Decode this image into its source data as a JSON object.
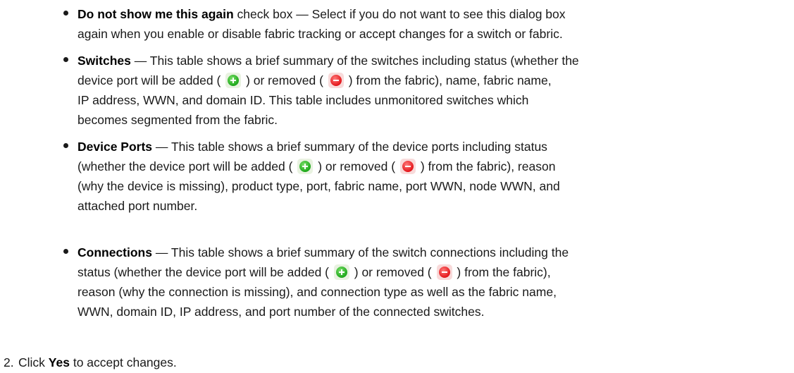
{
  "bullets": [
    {
      "term": "Do not show me this again",
      "lines": [
        " check box — Select if you do not want to see this dialog box",
        "again when you enable or disable fabric tracking or accept changes for a switch or fabric."
      ]
    },
    {
      "term": "Switches",
      "lines": [
        " — This table shows a brief summary of the switches including status (whether the",
        {
          "pre": "device port will be added (",
          "mid": ") or removed (",
          "post": ") from the fabric), name, fabric name,"
        },
        "IP address, WWN, and domain ID. This table includes unmonitored switches which",
        "becomes segmented from the fabric."
      ]
    },
    {
      "term": "Device Ports",
      "lines": [
        " — This table shows a brief summary of the device ports including status",
        {
          "pre": "(whether the device port will be added (",
          "mid": ") or removed (",
          "post": ") from the fabric), reason"
        },
        "(why the device is missing), product type, port, fabric name, port WWN, node WWN, and",
        "attached port number."
      ]
    },
    {
      "term": "Connections",
      "lines": [
        " — This table shows a brief summary of the switch connections including the",
        {
          "pre": "status (whether the device port will be added (",
          "mid": ") or removed (",
          "post": ") from the fabric),"
        },
        "reason (why the connection is missing), and connection type as well as the fabric name,",
        "WWN, domain ID, IP address, and port number of the connected switches."
      ]
    }
  ],
  "step": {
    "number": "2.",
    "pre": "Click ",
    "bold": "Yes",
    "post": " to accept changes."
  },
  "icons": {
    "add": "add-icon",
    "remove": "remove-icon",
    "add_color": "#1ea81b",
    "remove_color": "#e4161b"
  }
}
